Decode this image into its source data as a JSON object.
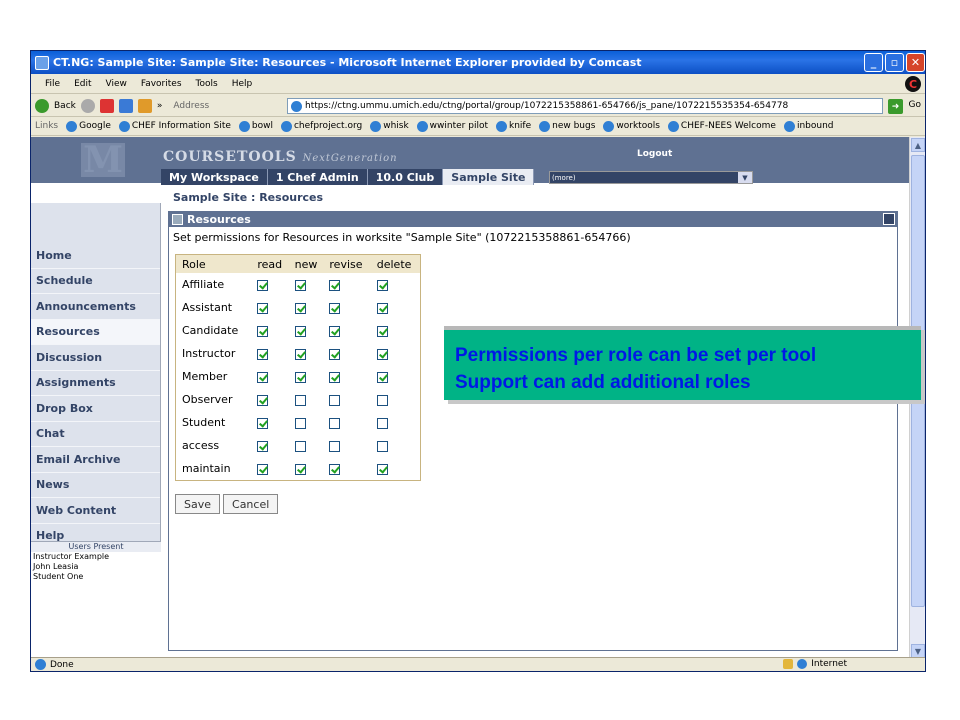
{
  "window": {
    "title": "CT.NG: Sample Site: Sample Site: Resources - Microsoft Internet Explorer provided by Comcast"
  },
  "menubar": [
    "File",
    "Edit",
    "View",
    "Favorites",
    "Tools",
    "Help"
  ],
  "toolbar": {
    "back_label": "Back",
    "address_label": "Address",
    "url": "https://ctng.ummu.umich.edu/ctng/portal/group/1072215358861-654766/js_pane/1072215535354-654778",
    "go_label": "Go",
    "chevron": "»"
  },
  "links": {
    "label": "Links",
    "items": [
      "Google",
      "CHEF Information Site",
      "bowl",
      "chefproject.org",
      "whisk",
      "wwinter pilot",
      "knife",
      "new bugs",
      "worktools",
      "CHEF-NEES Welcome",
      "inbound"
    ]
  },
  "header": {
    "logo_letter": "M",
    "brand": "COURSETOOLS",
    "brand_sub": "NextGeneration",
    "logout": "Logout",
    "tabs": [
      "My Workspace",
      "1 Chef Admin",
      "10.0 Club",
      "Sample Site"
    ],
    "more": "(more)"
  },
  "breadcrumb": "Sample Site : Resources",
  "nav": [
    "Home",
    "Schedule",
    "Announcements",
    "Resources",
    "Discussion",
    "Assignments",
    "Drop Box",
    "Chat",
    "Email Archive",
    "News",
    "Web Content",
    "Help"
  ],
  "users_present": {
    "title": "Users Present",
    "users": [
      "Instructor Example",
      "John Leasia",
      "Student One"
    ]
  },
  "tool": {
    "title": "Resources",
    "instructions": "Set permissions for Resources in worksite \"Sample Site\" (1072215358861-654766)",
    "columns": [
      "Role",
      "read",
      "new",
      "revise",
      "delete"
    ],
    "rows": [
      {
        "role": "Affiliate",
        "perms": [
          true,
          true,
          true,
          true
        ]
      },
      {
        "role": "Assistant",
        "perms": [
          true,
          true,
          true,
          true
        ]
      },
      {
        "role": "Candidate",
        "perms": [
          true,
          true,
          true,
          true
        ]
      },
      {
        "role": "Instructor",
        "perms": [
          true,
          true,
          true,
          true
        ]
      },
      {
        "role": "Member",
        "perms": [
          true,
          true,
          true,
          true
        ]
      },
      {
        "role": "Observer",
        "perms": [
          true,
          false,
          false,
          false
        ]
      },
      {
        "role": "Student",
        "perms": [
          true,
          false,
          false,
          false
        ]
      },
      {
        "role": "access",
        "perms": [
          true,
          false,
          false,
          false
        ]
      },
      {
        "role": "maintain",
        "perms": [
          true,
          true,
          true,
          true
        ]
      }
    ],
    "save_label": "Save",
    "cancel_label": "Cancel"
  },
  "callout": {
    "line1": "Permissions per role can be set per tool",
    "line2": "Support can add additional roles"
  },
  "status": {
    "text": "Done",
    "zone": "Internet"
  }
}
